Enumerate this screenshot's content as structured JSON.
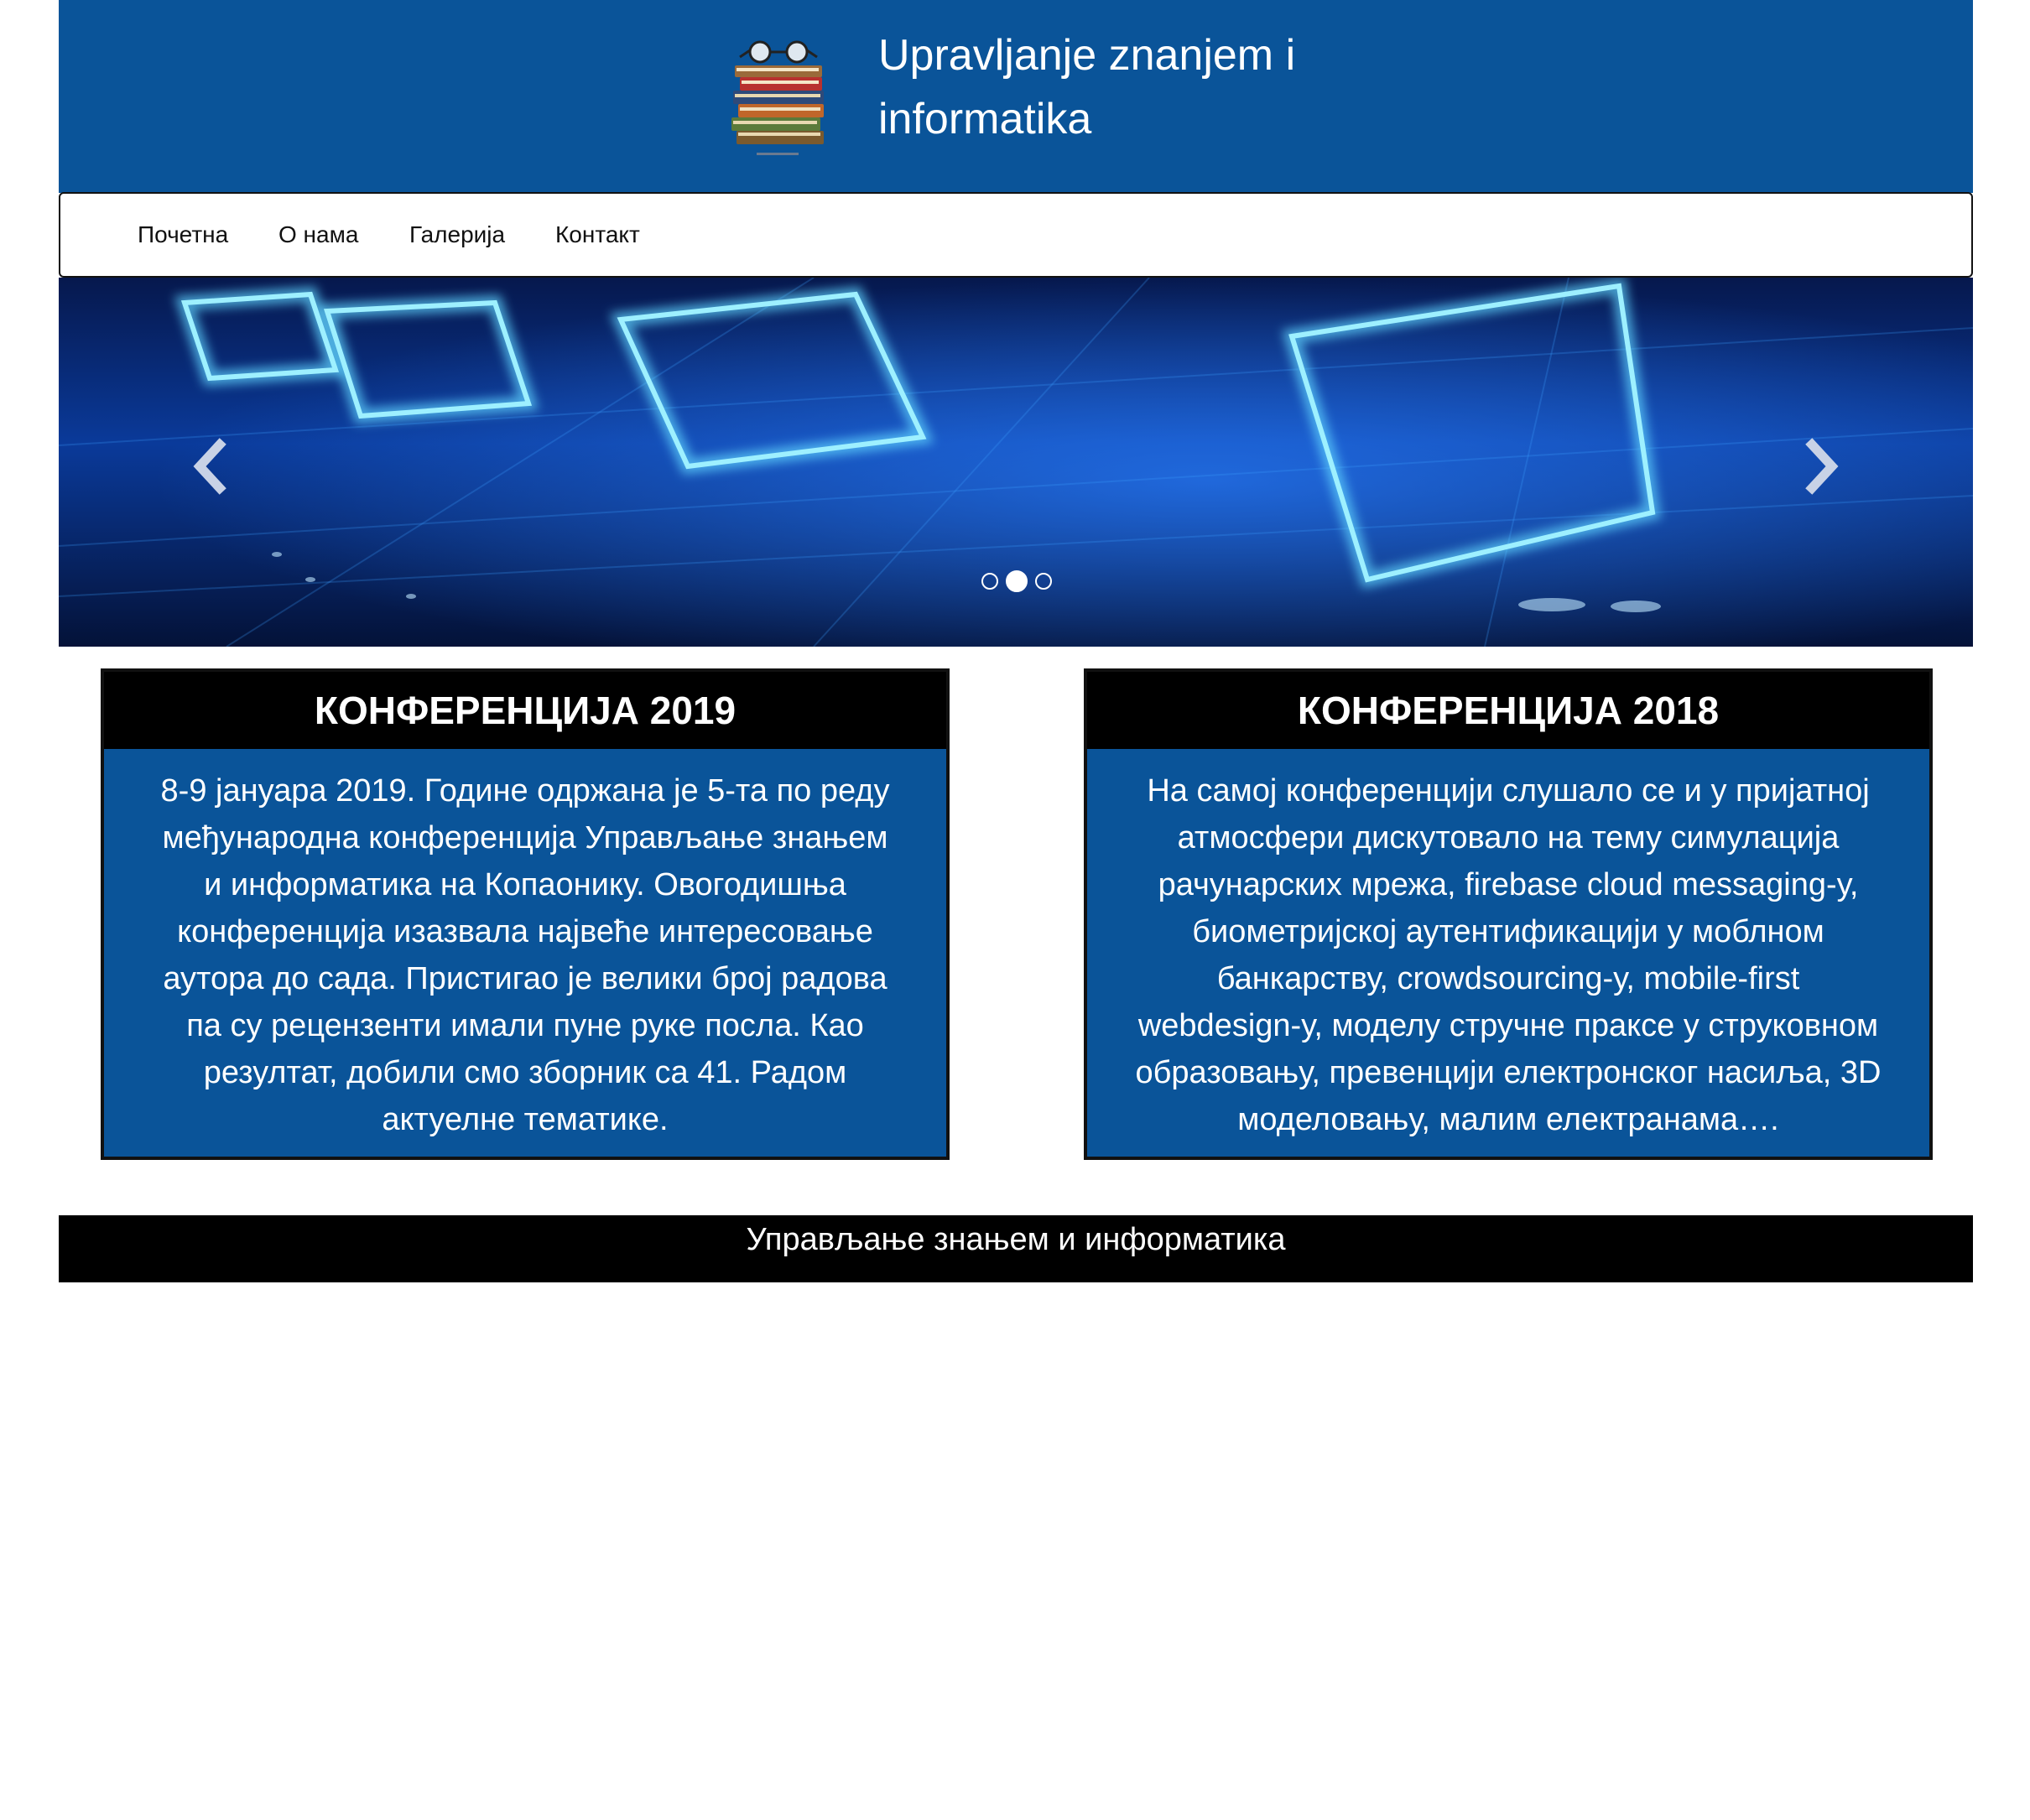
{
  "header": {
    "title_line1": "Upravljanje znanjem i",
    "title_line2": "informatika",
    "logo_icon": "books-with-glasses-logo"
  },
  "nav": {
    "items": [
      {
        "label": "Почетна"
      },
      {
        "label": "О нама"
      },
      {
        "label": "Галерија"
      },
      {
        "label": "Контакт"
      }
    ]
  },
  "carousel": {
    "prev_icon": "chevron-left-icon",
    "next_icon": "chevron-right-icon",
    "slide_count": 3,
    "active_slide": 2
  },
  "cards": [
    {
      "title": "КОНФЕРЕНЦИЈА 2019",
      "lines": [
        "8-9 јануара 2019. Године одржана је 5-та по реду",
        "међународна конференција Управљање знањем",
        "и информатика на Копаонику. Овогодишња",
        "конференција изазвала највеће интересовање",
        "аутора до сада. Пристигао је велики број радова",
        "па су рецензенти имали пуне руке посла. Као",
        "резултат, добили смо зборник са 41. Радом",
        "актуелне тематике."
      ]
    },
    {
      "title": "КОНФЕРЕНЦИЈА 2018",
      "lines": [
        "На самој конференцији слушало се и у пријатној",
        "атмосфери дискутовало на тему симулација",
        "рачунарских мрежа, firebase cloud messaging-у,",
        "биометријској аутентификацији у моблном",
        "банкарству, crowdsourcing-у, mobile-first",
        "webdesign-у, моделу стручне праксе у струковном",
        "образовању, превенцији електронског насиља, 3D",
        "моделовању, малим електранама…."
      ]
    }
  ],
  "footer": {
    "text": "Управљање знањем и информатика"
  },
  "colors": {
    "brand_blue": "#0a5499",
    "black": "#000000",
    "white": "#ffffff"
  }
}
